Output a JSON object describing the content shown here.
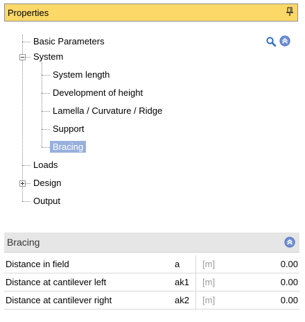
{
  "panel": {
    "title": "Properties"
  },
  "tree": {
    "basic_parameters": "Basic Parameters",
    "system": "System",
    "system_length": "System length",
    "development_of_height": "Development of height",
    "lamella": "Lamella / Curvature / Ridge",
    "support": "Support",
    "bracing": "Bracing",
    "loads": "Loads",
    "design": "Design",
    "output": "Output"
  },
  "section": {
    "title": "Bracing",
    "rows": [
      {
        "label": "Distance in field",
        "symbol": "a",
        "unit": "[m]",
        "value": "0.00"
      },
      {
        "label": "Distance at cantilever left",
        "symbol": "ak1",
        "unit": "[m]",
        "value": "0.00"
      },
      {
        "label": "Distance at cantilever right",
        "symbol": "ak2",
        "unit": "[m]",
        "value": "0.00"
      }
    ]
  },
  "colors": {
    "header_bg": "#fbd867",
    "selected_bg": "#98b0dd",
    "section_bg": "#e6e6e6",
    "icon_blue": "#6d8ed6"
  },
  "icons": [
    "pin-icon",
    "search-icon",
    "collapse-up-icon"
  ]
}
